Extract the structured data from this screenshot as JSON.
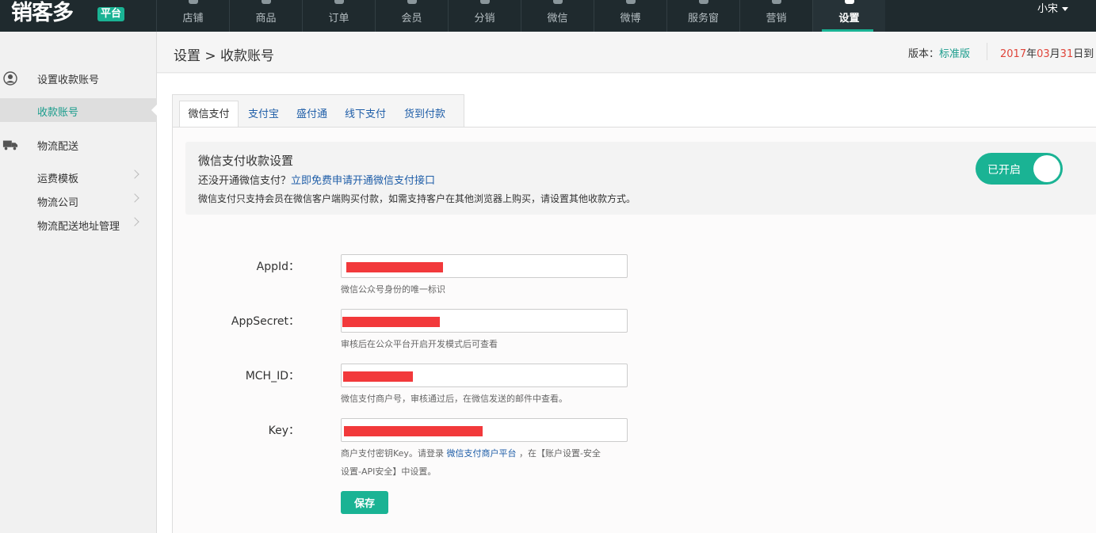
{
  "logo": {
    "text_main": "销客多",
    "badge": "平台"
  },
  "nav": {
    "items": [
      {
        "label": "店铺"
      },
      {
        "label": "商品"
      },
      {
        "label": "订单"
      },
      {
        "label": "会员"
      },
      {
        "label": "分销"
      },
      {
        "label": "微信"
      },
      {
        "label": "微博"
      },
      {
        "label": "服务窗"
      },
      {
        "label": "营销"
      },
      {
        "label": "设置"
      }
    ],
    "active": "设置"
  },
  "user": {
    "name": "小宋"
  },
  "sidebar": {
    "groups": [
      {
        "label": "设置收款账号",
        "icon": "user-circle-icon"
      },
      {
        "label": "物流配送",
        "icon": "truck-icon"
      }
    ],
    "items": [
      {
        "label": "收款账号"
      },
      {
        "label": "运费模板"
      },
      {
        "label": "物流公司"
      },
      {
        "label": "物流配送地址管理"
      }
    ]
  },
  "header": {
    "breadcrumb": "设置 > 收款账号",
    "version_label": "版本：",
    "version_value": "标准版",
    "expire": {
      "year": "2017",
      "y_suffix": "年",
      "month": "03",
      "m_suffix": "月",
      "day": "31",
      "d_suffix": "日到"
    }
  },
  "tabs": [
    {
      "label": "微信支付"
    },
    {
      "label": "支付宝"
    },
    {
      "label": "盛付通"
    },
    {
      "label": "线下支付"
    },
    {
      "label": "货到付款"
    }
  ],
  "info": {
    "title": "微信支付收款设置",
    "line1_prefix": "还没开通微信支付？",
    "line1_link": "立即免费申请开通微信支付接口",
    "line2": "微信支付只支持会员在微信客户端购买付款，如需支持客户在其他浏览器上购买，请设置其他收款方式。",
    "toggle_label": "已开启"
  },
  "form": {
    "appid": {
      "label": "AppId：",
      "help": "微信公众号身份的唯一标识"
    },
    "appsecret": {
      "label": "AppSecret：",
      "help": "审核后在公众平台开启开发模式后可查看"
    },
    "mchid": {
      "label": "MCH_ID：",
      "help": "微信支付商户号，审核通过后，在微信发送的邮件中查看。"
    },
    "key": {
      "label": "Key：",
      "help_prefix": "商户支付密钥Key。请登录",
      "help_link": "微信支付商户平台",
      "help_suffix": "，在【账户设置-安全",
      "help_line2": "设置-API安全】中设置。"
    },
    "save_label": "保存"
  },
  "colors": {
    "accent": "#1ab394",
    "link": "#1f5ea8",
    "date_red": "#e0453a",
    "redact": "#f2393b",
    "topbar": "#1f2a2e"
  }
}
